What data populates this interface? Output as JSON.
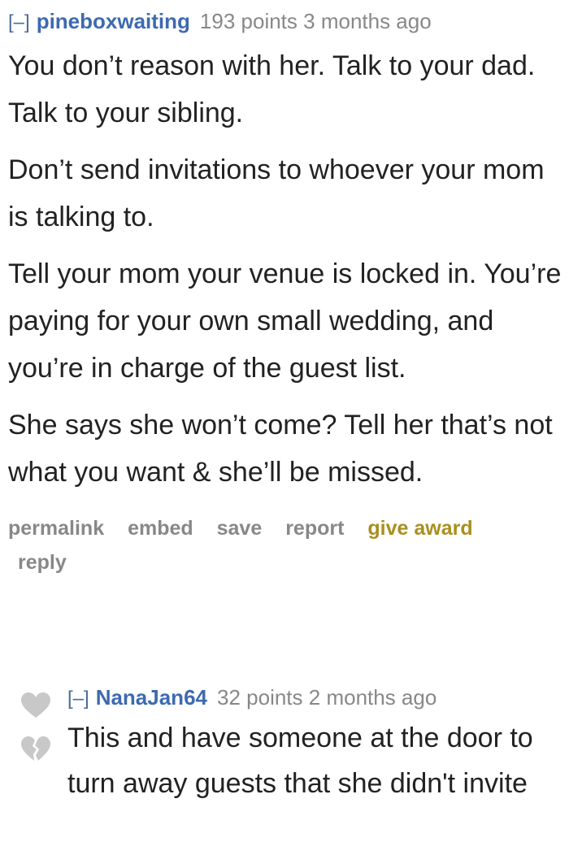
{
  "comment": {
    "toggle": "[–]",
    "author": "pineboxwaiting",
    "score": "193 points",
    "time": "3 months ago",
    "paragraphs": [
      "You don’t reason with her. Talk to your dad. Talk to your sibling.",
      "Don’t send invitations to whoever your mom is talking to.",
      "Tell your mom your venue is locked in. You’re paying for your own small wedding, and you’re in charge of the guest list.",
      "She says she won’t come? Tell her that’s not what you want & she’ll be missed."
    ],
    "buttons": {
      "permalink": "permalink",
      "embed": "embed",
      "save": "save",
      "report": "report",
      "give_award": "give award",
      "reply": "reply"
    }
  },
  "reply": {
    "toggle": "[–]",
    "author": "NanaJan64",
    "score": "32 points",
    "time": "2 months ago",
    "text": "This and have someone at the door to turn away guests that she didn't invite",
    "upvote_icon": "heart-upvote-icon",
    "downvote_icon": "broken-heart-downvote-icon"
  },
  "colors": {
    "author": "#3d6ab0",
    "meta": "#888888",
    "award": "#a98f1f",
    "text": "#222222",
    "vote_icon": "#c8c8c8"
  }
}
